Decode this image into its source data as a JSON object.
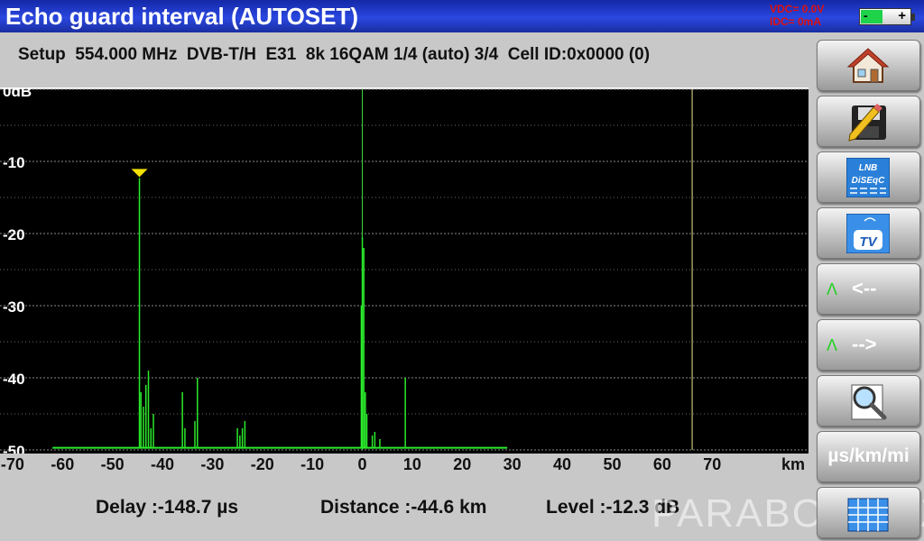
{
  "header": {
    "title": "Echo guard interval (AUTOSET)",
    "vdc": "VDC= 0.0V",
    "idc": "IDC= 0mA",
    "battery": {
      "minus": "-",
      "plus": "+",
      "level": 0.45
    }
  },
  "setup_line": "Setup  554.000 MHz  DVB-T/H  E31  8k 16QAM 1/4 (auto) 3/4  Cell ID:0x0000 (0)",
  "readout": {
    "delay": "Delay :-148.7 µs",
    "distance": "Distance :-44.6 km",
    "level": "Level :-12.3 dB"
  },
  "watermark": "PARABOLA.CZ",
  "buttons": {
    "home": "home",
    "save": "save",
    "lnb_line1": "LNB",
    "lnb_line2": "DiSEqC",
    "tv": "TV",
    "prev_label": "<--",
    "next_label": "-->",
    "lambda": "Λ",
    "zoom": "zoom",
    "units": "µs/km/mi",
    "calc": "grid"
  },
  "chart_data": {
    "type": "bar",
    "xlabel": "km",
    "ylabel": "",
    "xlim": [
      -72.5,
      90
    ],
    "ylim": [
      -50,
      0
    ],
    "y_ticks": [
      "0dB",
      "-10",
      "-20",
      "-30",
      "-40",
      "-50"
    ],
    "x_ticks": [
      -70,
      -60,
      -50,
      -40,
      -30,
      -20,
      -10,
      0,
      10,
      20,
      30,
      40,
      50,
      60,
      70
    ],
    "grid": true,
    "marker": {
      "x": -44.6,
      "y": -12.3
    },
    "vertical_lines": [
      0,
      66
    ],
    "noise_floor": {
      "x": [
        -62,
        29
      ],
      "y": -49.7
    },
    "echoes": [
      {
        "x": -44.6,
        "y": -12.3
      },
      {
        "x": -44.3,
        "y": -42
      },
      {
        "x": -43.8,
        "y": -44
      },
      {
        "x": -43.3,
        "y": -41
      },
      {
        "x": -42.8,
        "y": -39
      },
      {
        "x": -42.3,
        "y": -47
      },
      {
        "x": -41.8,
        "y": -45
      },
      {
        "x": -36,
        "y": -42
      },
      {
        "x": -35.5,
        "y": -47
      },
      {
        "x": -33.5,
        "y": -46
      },
      {
        "x": -33,
        "y": -40
      },
      {
        "x": -25,
        "y": -47
      },
      {
        "x": -24.5,
        "y": -48
      },
      {
        "x": -24,
        "y": -47
      },
      {
        "x": -23.5,
        "y": -46
      },
      {
        "x": -0.2,
        "y": -30
      },
      {
        "x": 0,
        "y": -20.5
      },
      {
        "x": 0.3,
        "y": -22
      },
      {
        "x": 0.6,
        "y": -42
      },
      {
        "x": 0.9,
        "y": -45
      },
      {
        "x": 2,
        "y": -48
      },
      {
        "x": 2.5,
        "y": -47.5
      },
      {
        "x": 3.5,
        "y": -48.5
      },
      {
        "x": 8.6,
        "y": -40
      }
    ]
  },
  "colors": {
    "plot_bg": "#000000",
    "trace": "#2bea2b",
    "marker": "#f5e100",
    "cursor_line": "#e8e88a",
    "header_bg": "#2a47e0"
  }
}
